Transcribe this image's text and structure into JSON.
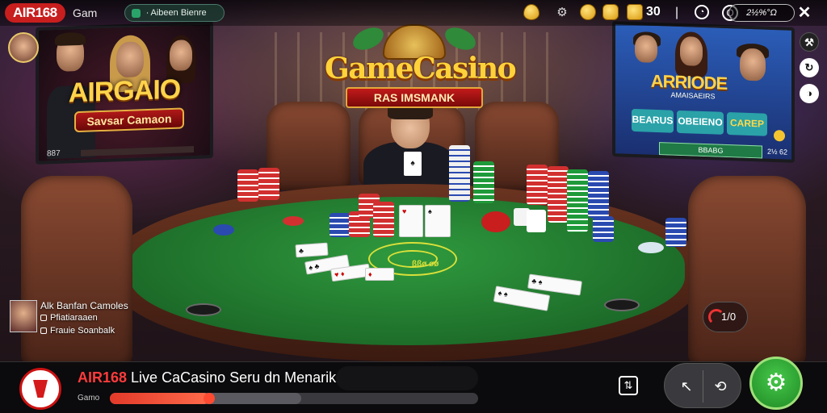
{
  "topbar": {
    "brand": "AIR168",
    "game_label": "Gam",
    "status_text": "∙ Aibeen Bienre",
    "score": "30",
    "balance": "2½%°Ω"
  },
  "left_screen": {
    "title": "AIRGAIO",
    "banner": "Savsar Camaon",
    "footer": "887"
  },
  "logo": {
    "title": "GameCasino",
    "ribbon": "RAS IMSMANK"
  },
  "right_screen": {
    "title": "ARRIODE",
    "subtitle": "AMAISAEIRS",
    "buttons": [
      "BEARUS",
      "OBEIENO",
      "CAREP"
    ],
    "bar_text": "BBABG",
    "odds": "2½ 62"
  },
  "table": {
    "felt_text": "ßßø øø"
  },
  "chat": {
    "line1": "Alk Banfan Camoles",
    "line2": "Pfiatiaraaen",
    "line3": "Frauie Soanbalk"
  },
  "timer": {
    "text": "1/0"
  },
  "bottombar": {
    "brand": "AIR168",
    "title": "Live CaCasino Seru dn Menarik",
    "label": "Gamo",
    "progress": 0.27,
    "buffer": 0.52
  },
  "colors": {
    "brand_red": "#c81e1e",
    "felt_green": "#2f9a3e",
    "gold": "#ffd23a",
    "settings_green": "#46c84a"
  },
  "icons": {
    "close": "close-icon",
    "settings": "gear-icon",
    "share": "share-icon",
    "back": "back-icon",
    "refresh": "refresh-icon"
  }
}
